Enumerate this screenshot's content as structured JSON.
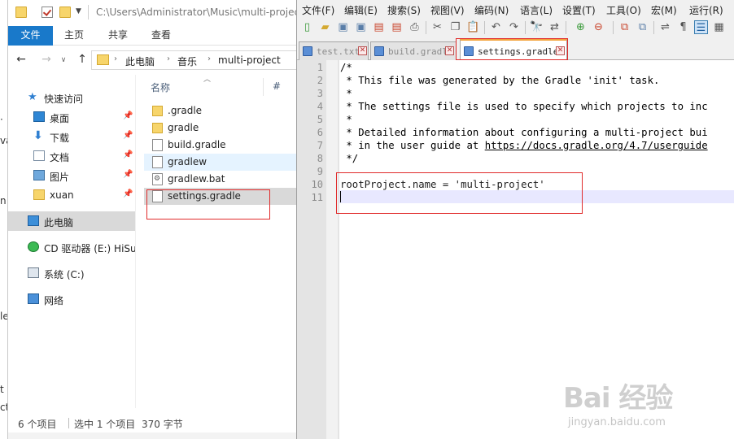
{
  "background_fragments": [
    "·",
    "va",
    "n",
    "le",
    "t",
    "ct"
  ],
  "explorer": {
    "title_path": "C:\\Users\\Administrator\\Music\\multi-project",
    "ribbon_tabs": [
      "文件",
      "主页",
      "共享",
      "查看"
    ],
    "breadcrumb": [
      "此电脑",
      "音乐",
      "multi-project"
    ],
    "nav_items": [
      {
        "label": "快速访问",
        "icon": "star-icon",
        "pinned": false
      },
      {
        "label": "桌面",
        "icon": "desktop-icon",
        "pinned": true
      },
      {
        "label": "下载",
        "icon": "download-icon",
        "pinned": true
      },
      {
        "label": "文档",
        "icon": "document-icon",
        "pinned": true
      },
      {
        "label": "图片",
        "icon": "pictures-icon",
        "pinned": true
      },
      {
        "label": "xuan",
        "icon": "folder-icon",
        "pinned": true
      },
      {
        "label": "此电脑",
        "icon": "computer-icon",
        "pinned": false
      },
      {
        "label": "CD 驱动器 (E:) HiSui",
        "icon": "cd-drive-icon",
        "pinned": false
      },
      {
        "label": "系统 (C:)",
        "icon": "system-drive-icon",
        "pinned": false
      },
      {
        "label": "网络",
        "icon": "network-icon",
        "pinned": false
      }
    ],
    "columns": {
      "name": "名称",
      "hash": "#"
    },
    "files": [
      {
        "name": ".gradle",
        "type": "folder"
      },
      {
        "name": "gradle",
        "type": "folder"
      },
      {
        "name": "build.gradle",
        "type": "file"
      },
      {
        "name": "gradlew",
        "type": "file"
      },
      {
        "name": "gradlew.bat",
        "type": "batch"
      },
      {
        "name": "settings.gradle",
        "type": "file"
      }
    ],
    "status": {
      "count": "6 个项目",
      "selected": "选中 1 个项目",
      "size": "370 字节"
    }
  },
  "npp": {
    "menus": [
      "文件(F)",
      "编辑(E)",
      "搜索(S)",
      "视图(V)",
      "编码(N)",
      "语言(L)",
      "设置(T)",
      "工具(O)",
      "宏(M)",
      "运行(R)"
    ],
    "tabs": [
      {
        "label": "test.txt",
        "active": false
      },
      {
        "label": "build.gradle",
        "active": false
      },
      {
        "label": "settings.gradle",
        "active": true
      }
    ],
    "line_numbers": [
      "1",
      "2",
      "3",
      "4",
      "5",
      "6",
      "7",
      "8",
      "9",
      "10",
      "11"
    ],
    "code_lines": [
      "/*",
      " * This file was generated by the Gradle 'init' task.",
      " *",
      " * The settings file is used to specify which projects to inc",
      " *",
      " * Detailed information about configuring a multi-project bui",
      " * in the user guide at ",
      " */",
      "",
      "rootProject.name = 'multi-project'",
      ""
    ],
    "code_url": "https://docs.gradle.org/4.7/userguide"
  },
  "watermark": {
    "brand": "Bai 经验",
    "url": "jingyan.baidu.com"
  },
  "colors": {
    "accent": "#1979ca",
    "annotation": "#e02b2b",
    "active_tab": "#f3a23a"
  }
}
